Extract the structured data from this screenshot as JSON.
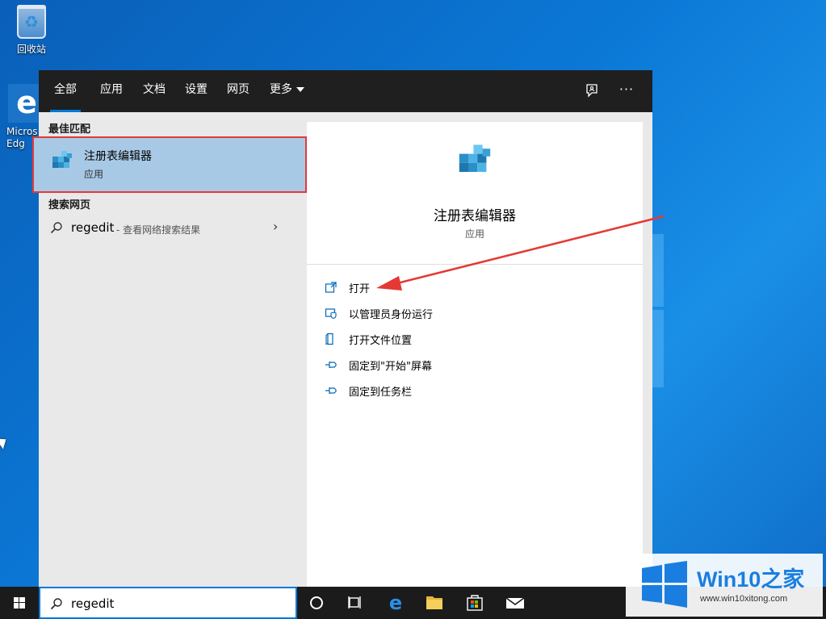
{
  "desktop": {
    "recycle_label": "回收站",
    "edge_label": "Micros\nEdg"
  },
  "search_panel": {
    "tabs": [
      {
        "label": "全部",
        "active": true
      },
      {
        "label": "应用"
      },
      {
        "label": "文档"
      },
      {
        "label": "设置"
      },
      {
        "label": "网页"
      },
      {
        "label": "更多"
      }
    ],
    "feedback_icon": "feedback-icon",
    "more_icon": "···",
    "best_match_title": "最佳匹配",
    "best_match": {
      "name": "注册表编辑器",
      "type": "应用",
      "icon": "registry-editor-icon"
    },
    "web_title": "搜索网页",
    "web_result": {
      "query": "regedit",
      "hint": "- 查看网络搜索结果"
    },
    "detail": {
      "name": "注册表编辑器",
      "type": "应用",
      "actions": [
        {
          "label": "打开",
          "icon": "open-icon"
        },
        {
          "label": "以管理员身份运行",
          "icon": "shield-icon"
        },
        {
          "label": "打开文件位置",
          "icon": "folder-location-icon"
        },
        {
          "label": "固定到\"开始\"屏幕",
          "icon": "pin-icon"
        },
        {
          "label": "固定到任务栏",
          "icon": "pin-icon"
        }
      ]
    },
    "annotation_color": "#e53935",
    "accent_color": "#0078d7"
  },
  "taskbar": {
    "search_value": "regedit"
  },
  "watermark": {
    "brand": "Win10",
    "brand_zh": "之家",
    "url": "www.win10xitong.com"
  }
}
